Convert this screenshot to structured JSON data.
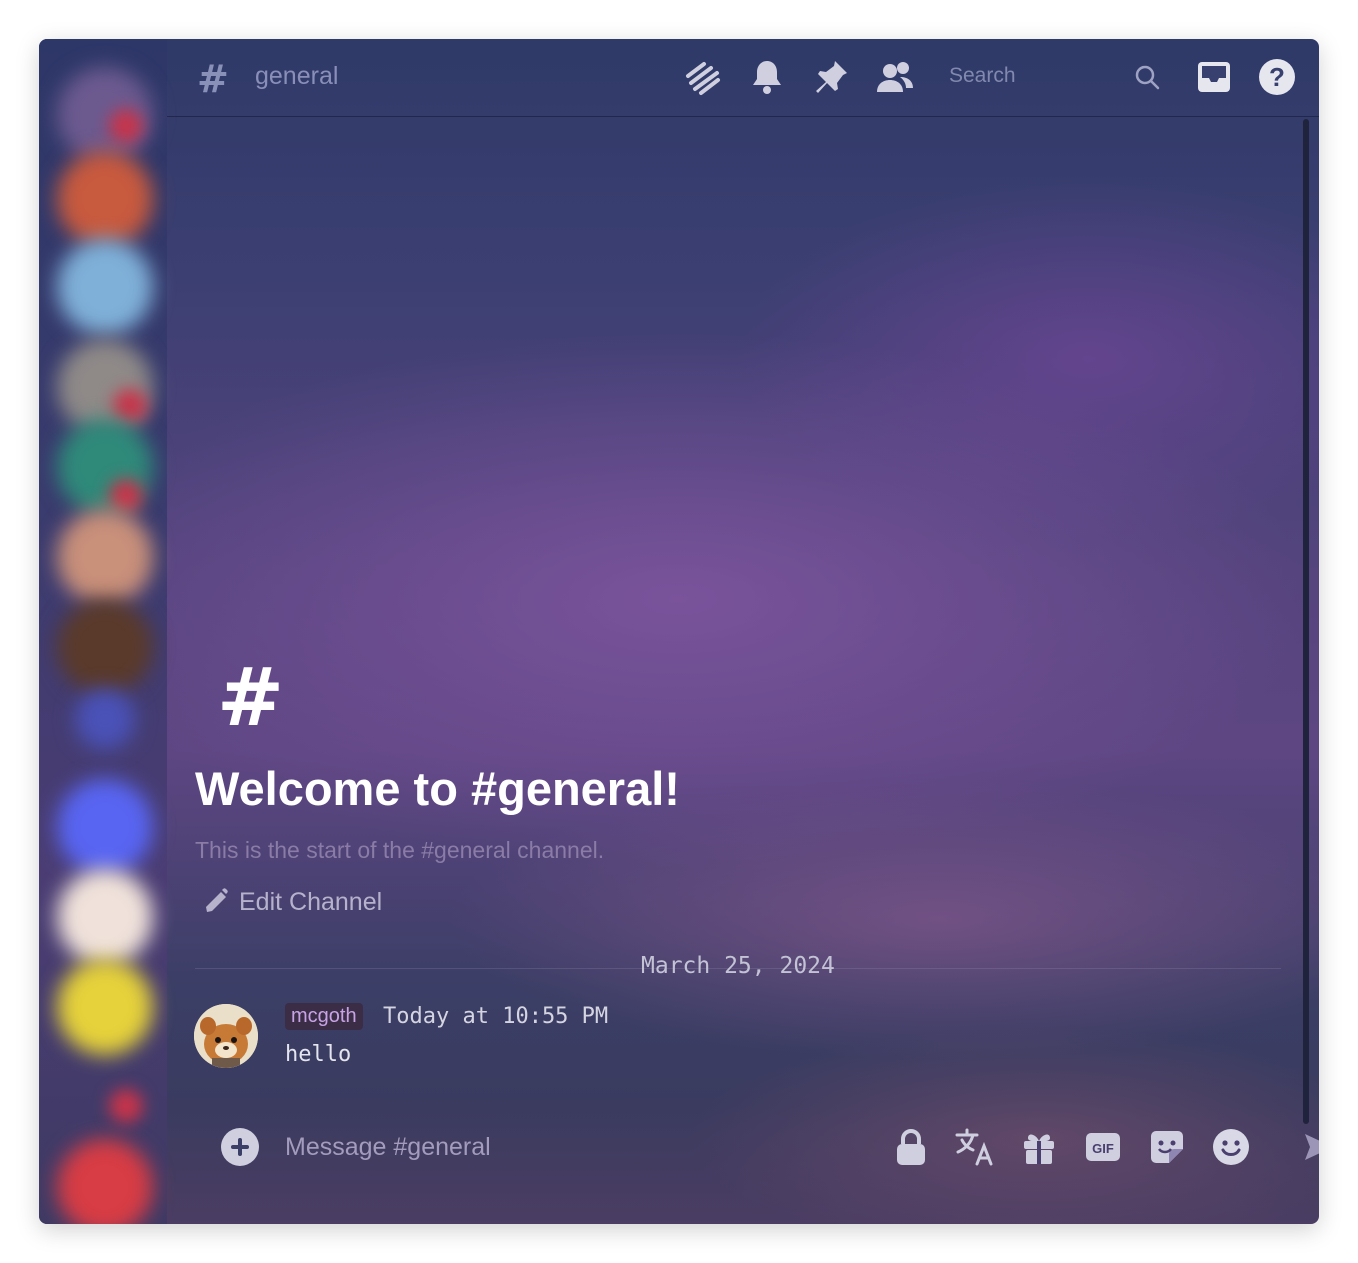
{
  "header": {
    "channel_name": "general",
    "search_placeholder": "Search"
  },
  "welcome": {
    "title": "Welcome to #general!",
    "subtitle": "This is the start of the #general channel.",
    "edit_label": "Edit Channel"
  },
  "divider": {
    "date": "March 25, 2024"
  },
  "message": {
    "username": "mcgoth",
    "timestamp": "Today at 10:55 PM",
    "text": "hello"
  },
  "composer": {
    "placeholder": "Message #general",
    "gif_label": "GIF"
  },
  "colors": {
    "icon": "#cfcfe0",
    "username_bg": "#3b2d46",
    "username_text": "#c7a3e6"
  },
  "icons": [
    "threads-icon",
    "bell-icon",
    "pin-icon",
    "members-icon",
    "search-icon",
    "inbox-icon",
    "help-icon",
    "pencil-icon",
    "plus-icon",
    "lock-icon",
    "translate-icon",
    "gift-icon",
    "gif-icon",
    "sticker-icon",
    "emoji-icon",
    "send-icon"
  ]
}
